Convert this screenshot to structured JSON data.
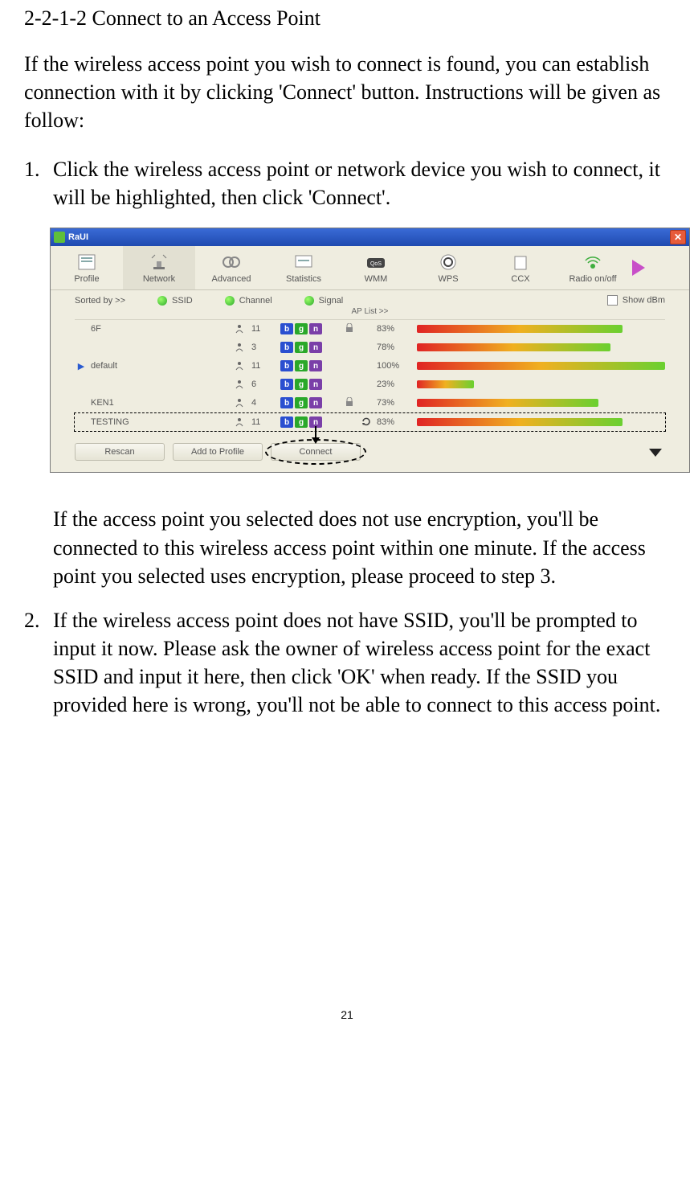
{
  "doc": {
    "heading": "2-2-1-2 Connect to an Access Point",
    "intro": "If the wireless access point you wish to connect is found, you can establish connection with it by clicking 'Connect' button. Instructions will be given as follow:",
    "step1_num": "1.",
    "step1_text": "Click the wireless access point or network device you wish to connect, it will be highlighted, then click 'Connect'.",
    "after_shot": "If the access point you selected does not use encryption, you'll be connected to this wireless access point within one minute. If the access point you selected uses encryption, please proceed to step 3.",
    "step2_num": "2.",
    "step2_text": "If the wireless access point does not have SSID, you'll be prompted to input it now. Please ask the owner of wireless access point for the exact SSID and input it here, then click 'OK' when ready. If the SSID you provided here is wrong, you'll not be able to connect to this access point.",
    "page_number": "21"
  },
  "window": {
    "title": "RaUI",
    "tabs": {
      "profile": "Profile",
      "network": "Network",
      "advanced": "Advanced",
      "statistics": "Statistics",
      "wmm": "WMM",
      "wps": "WPS",
      "ccx": "CCX",
      "radio": "Radio on/off"
    },
    "sort": {
      "sorted_by": "Sorted by >>",
      "ssid": "SSID",
      "channel": "Channel",
      "signal": "Signal",
      "show_dbm": "Show dBm",
      "ap_list": "AP List >>"
    },
    "rows": [
      {
        "ssid": "6F",
        "ch": "11",
        "lock": true,
        "refresh": false,
        "pct": "83%",
        "sig": 83
      },
      {
        "ssid": "",
        "ch": "3",
        "lock": false,
        "refresh": false,
        "pct": "78%",
        "sig": 78
      },
      {
        "ssid": "default",
        "ch": "11",
        "lock": false,
        "refresh": false,
        "pct": "100%",
        "sig": 100,
        "marker": true
      },
      {
        "ssid": "",
        "ch": "6",
        "lock": false,
        "refresh": false,
        "pct": "23%",
        "sig": 23
      },
      {
        "ssid": "KEN1",
        "ch": "4",
        "lock": true,
        "refresh": false,
        "pct": "73%",
        "sig": 73
      },
      {
        "ssid": "TESTING",
        "ch": "11",
        "lock": false,
        "refresh": true,
        "pct": "83%",
        "sig": 83,
        "selected": true
      }
    ],
    "buttons": {
      "rescan": "Rescan",
      "add_to_profile": "Add to Profile",
      "connect": "Connect"
    }
  }
}
